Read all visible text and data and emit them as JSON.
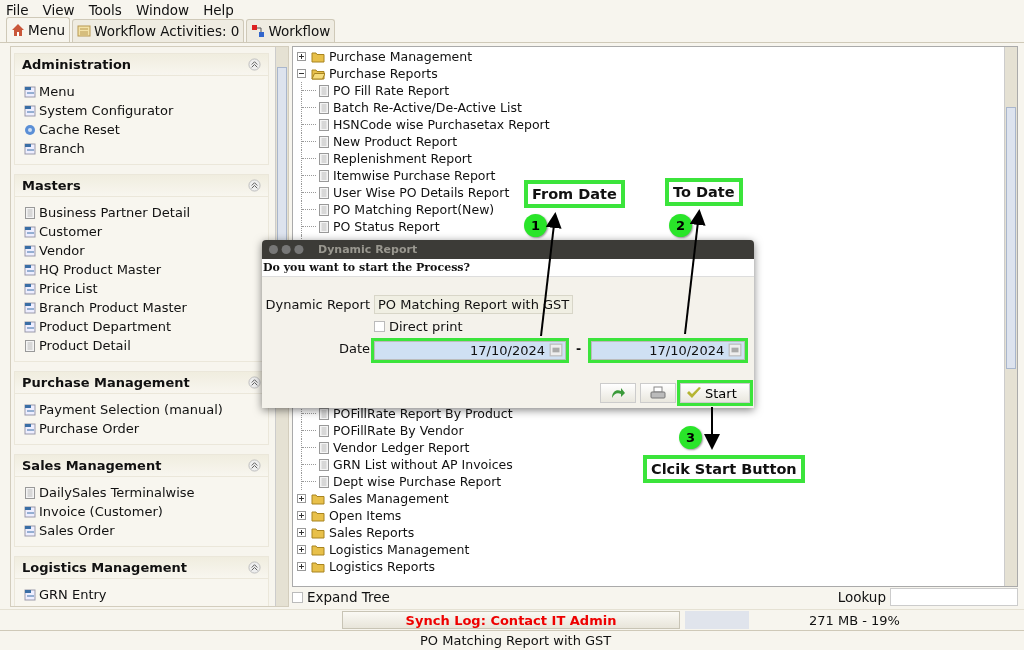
{
  "menu_bar": [
    "File",
    "View",
    "Tools",
    "Window",
    "Help"
  ],
  "tabs": [
    {
      "label": "Menu",
      "selected": true
    },
    {
      "label": "Workflow Activities: 0",
      "selected": false
    },
    {
      "label": "Workflow",
      "selected": false
    }
  ],
  "sidebar": {
    "sections": [
      {
        "title": "Administration",
        "items": [
          {
            "label": "Menu",
            "kind": "window"
          },
          {
            "label": "System Configurator",
            "kind": "window"
          },
          {
            "label": "Cache Reset",
            "kind": "process"
          },
          {
            "label": "Branch",
            "kind": "window"
          }
        ]
      },
      {
        "title": "Masters",
        "items": [
          {
            "label": "Business Partner Detail",
            "kind": "report"
          },
          {
            "label": "Customer",
            "kind": "window"
          },
          {
            "label": "Vendor",
            "kind": "window"
          },
          {
            "label": "HQ Product Master",
            "kind": "window"
          },
          {
            "label": "Price List",
            "kind": "window"
          },
          {
            "label": "Branch Product Master",
            "kind": "window"
          },
          {
            "label": "Product Department",
            "kind": "window"
          },
          {
            "label": "Product Detail",
            "kind": "report"
          }
        ]
      },
      {
        "title": "Purchase Management",
        "items": [
          {
            "label": "Payment Selection (manual)",
            "kind": "window"
          },
          {
            "label": "Purchase Order",
            "kind": "window"
          }
        ]
      },
      {
        "title": "Sales Management",
        "items": [
          {
            "label": "DailySales Terminalwise",
            "kind": "report"
          },
          {
            "label": "Invoice (Customer)",
            "kind": "window"
          },
          {
            "label": "Sales Order",
            "kind": "window"
          }
        ]
      },
      {
        "title": "Logistics Management",
        "items": [
          {
            "label": "GRN Entry",
            "kind": "window"
          }
        ]
      }
    ]
  },
  "tree": [
    {
      "label": "Purchase Management",
      "expanded": false
    },
    {
      "label": "Purchase Reports",
      "expanded": true,
      "children": [
        {
          "label": "PO Fill Rate Report"
        },
        {
          "label": "Batch Re-Active/De-Active List"
        },
        {
          "label": "HSNCode wise Purchasetax Report"
        },
        {
          "label": "New Product Report"
        },
        {
          "label": "Replenishment Report"
        },
        {
          "label": "Itemwise Purchase Report"
        },
        {
          "label": "User Wise PO Details Report"
        },
        {
          "label": "PO Matching Report(New)"
        },
        {
          "label": "PO Status Report"
        },
        {
          "label": "POFillRate Report By Product"
        },
        {
          "label": "POFillRate By Vendor"
        },
        {
          "label": "Vendor Ledger Report"
        },
        {
          "label": "GRN List without AP Invoices"
        },
        {
          "label": "Dept wise Purchase Report"
        }
      ]
    },
    {
      "label": "Sales Management",
      "expanded": false
    },
    {
      "label": "Open Items",
      "expanded": false
    },
    {
      "label": "Sales Reports",
      "expanded": false
    },
    {
      "label": "Logistics Management",
      "expanded": false
    },
    {
      "label": "Logistics Reports",
      "expanded": false
    }
  ],
  "expand_tree": {
    "label": "Expand Tree",
    "checked": false
  },
  "lookup": {
    "label": "Lookup"
  },
  "status_bar": {
    "synch_log": "Synch Log: Contact IT Admin",
    "memory": "271 MB - 19%",
    "current": "PO Matching Report with GST"
  },
  "dialog": {
    "title": "Dynamic Report",
    "prompt": "Do you want to start the Process?",
    "report_label": "Dynamic Report",
    "report_value": "PO Matching Report with GST",
    "direct_print": {
      "label": "Direct print",
      "checked": false
    },
    "date_label": "Date",
    "date_separator": "-",
    "date_from": {
      "value": "17/10/2024",
      "highlighted": true
    },
    "date_to": {
      "value": "17/10/2024",
      "highlighted": true
    },
    "start_button": {
      "label": "Start",
      "highlighted": true
    }
  },
  "annotations": [
    {
      "number": "1",
      "label": "From Date"
    },
    {
      "number": "2",
      "label": "To Date"
    },
    {
      "number": "3",
      "label": "Clcik Start Button"
    }
  ]
}
